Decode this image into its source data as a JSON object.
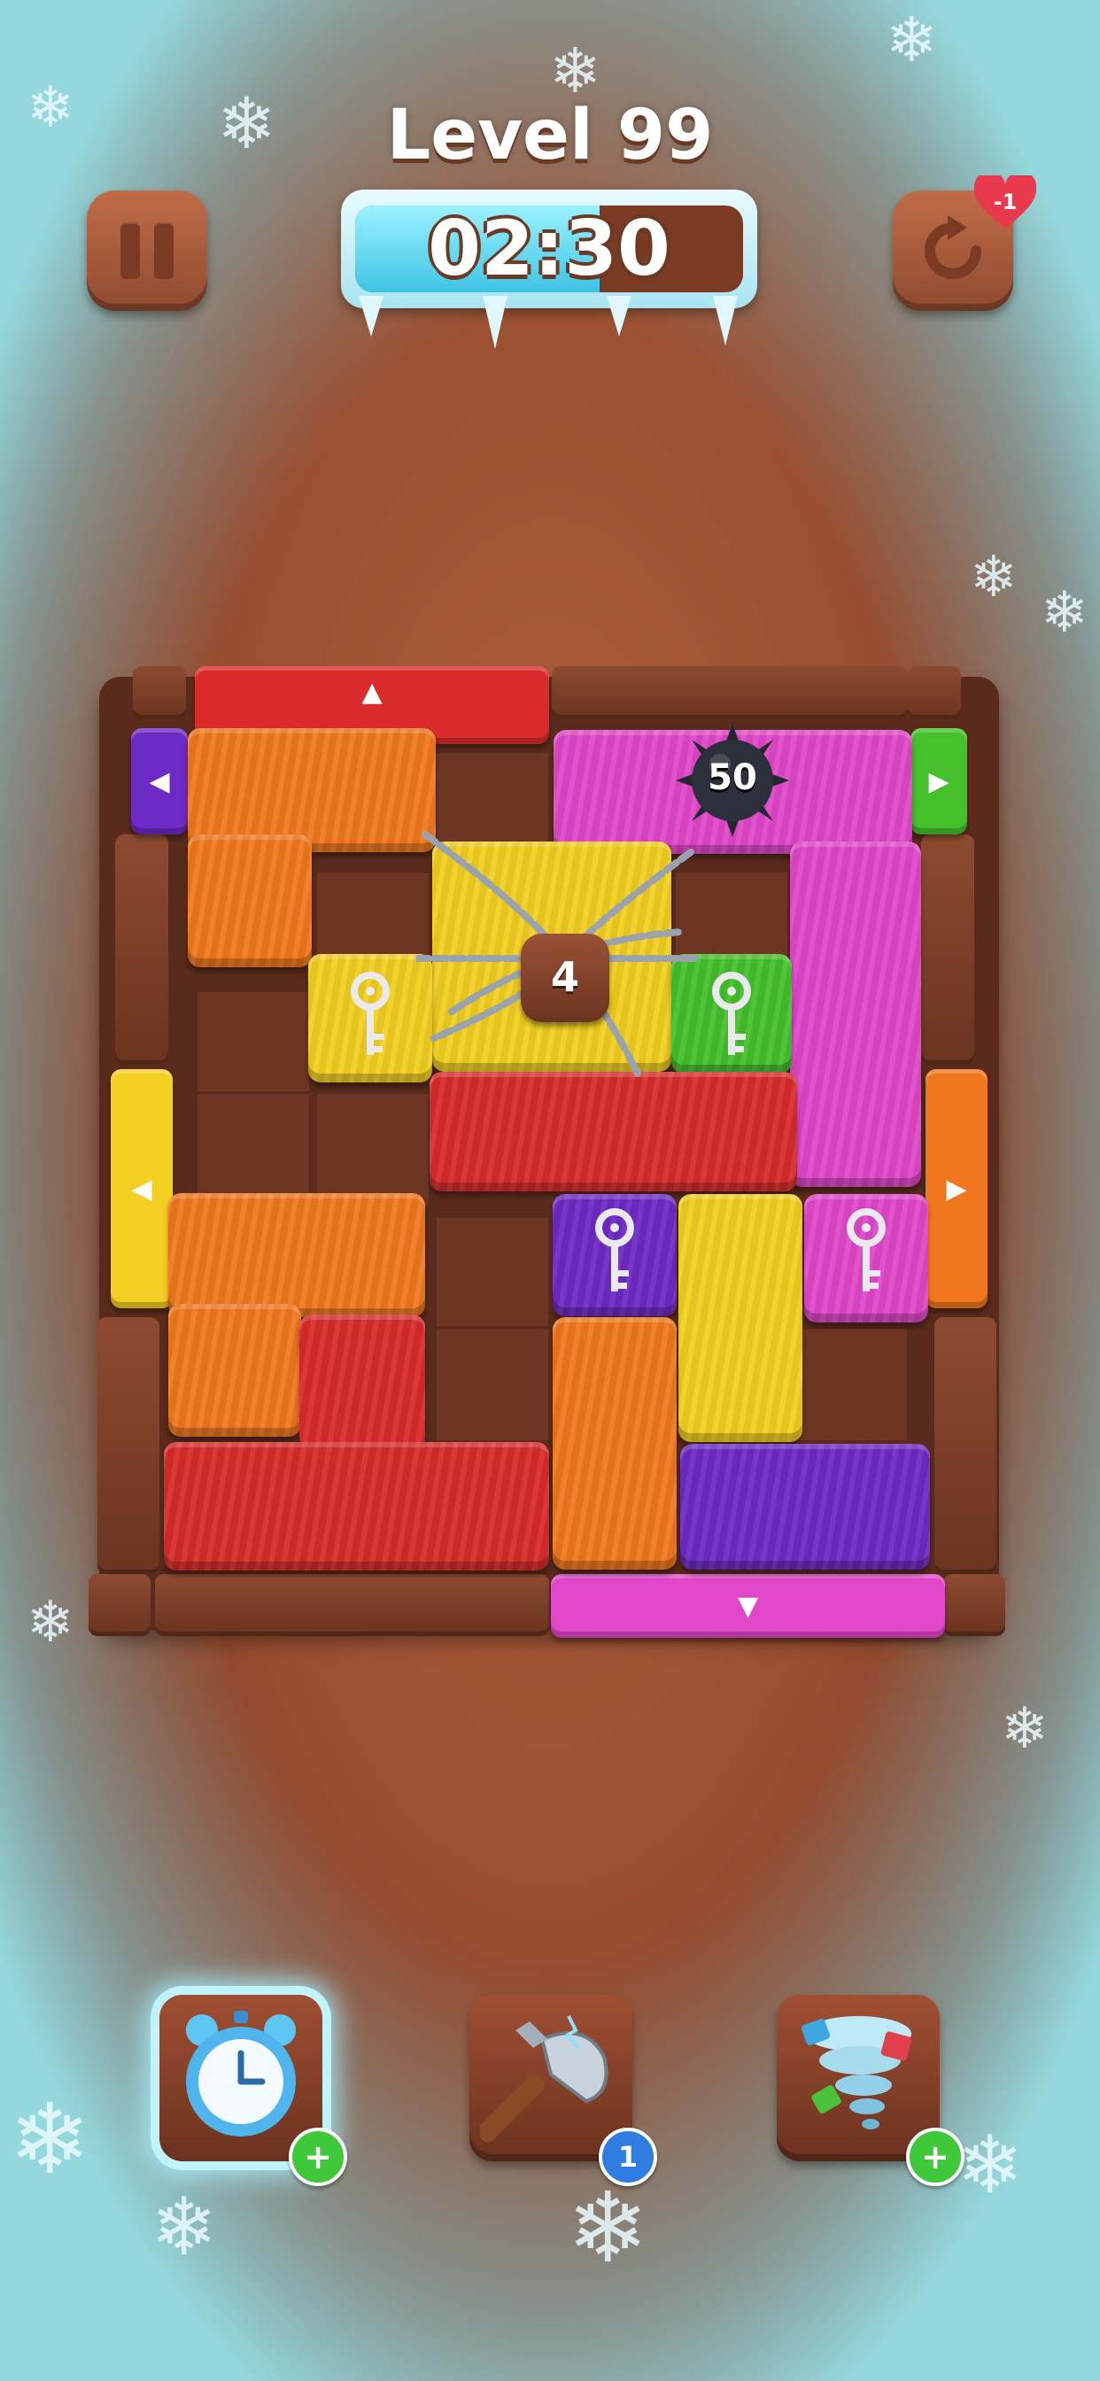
{
  "header": {
    "level_title": "Level 99",
    "timer": "02:30",
    "timer_progress": 0.63,
    "restart_cost": "-1"
  },
  "board": {
    "bomb_moves": "50",
    "lock_count": "4"
  },
  "boosters": {
    "clock": {
      "icon": "alarm-clock-icon",
      "badge": "+"
    },
    "axe": {
      "icon": "axe-icon",
      "badge": "1"
    },
    "tornado": {
      "icon": "tornado-icon",
      "badge": "+"
    }
  },
  "colors": {
    "red": "#d92b2b",
    "orange": "#f0771e",
    "yellow": "#f2cf22",
    "magenta": "#e047c9",
    "purple": "#6e2ac4",
    "green": "#44c02c",
    "wood": "#9a4f31",
    "frost": "#96e1e8"
  }
}
